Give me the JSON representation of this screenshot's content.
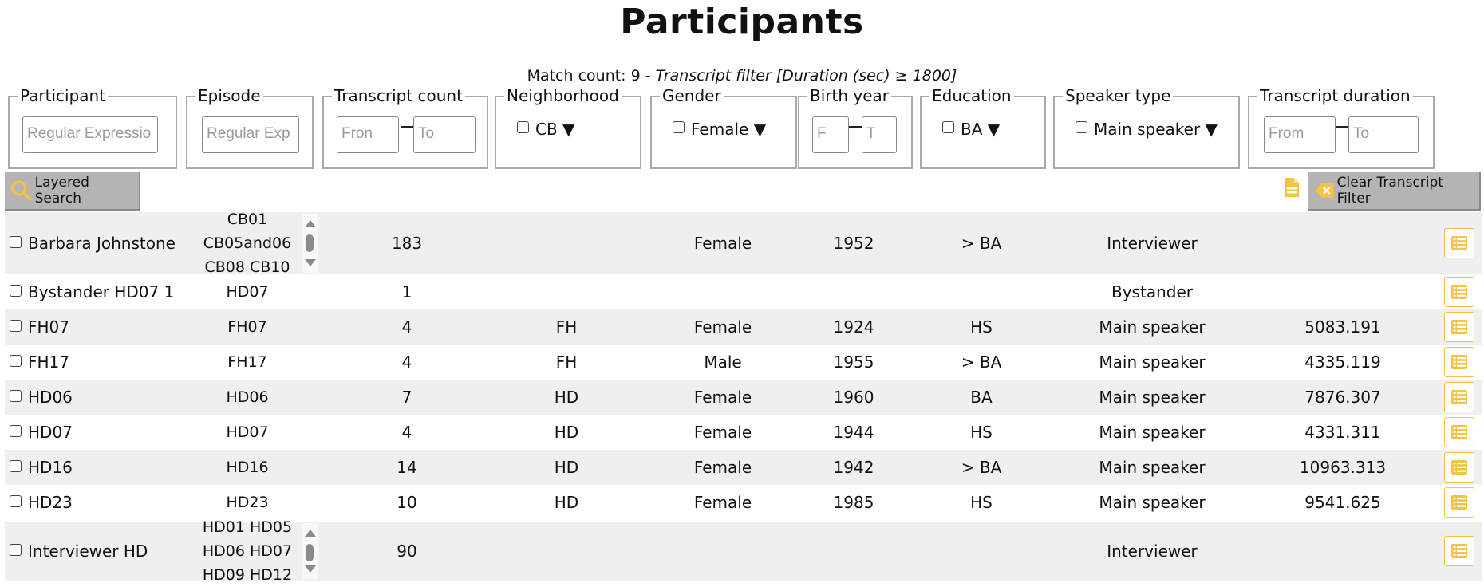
{
  "title": "Participants",
  "match": {
    "prefix": "Match count: 9 - ",
    "filter": "Transcript filter [Duration (sec) ≥ 1800]"
  },
  "filters": {
    "participant": {
      "legend": "Participant",
      "placeholder": "Regular Expressio"
    },
    "episode": {
      "legend": "Episode",
      "placeholder": "Regular Exp"
    },
    "transcript_count": {
      "legend": "Transcript count",
      "from": "Fron",
      "to": "To"
    },
    "neighborhood": {
      "legend": "Neighborhood",
      "value": "CB"
    },
    "gender": {
      "legend": "Gender",
      "value": "Female"
    },
    "birth_year": {
      "legend": "Birth year",
      "from": "F",
      "to": "T"
    },
    "education": {
      "legend": "Education",
      "value": "BA"
    },
    "speaker_type": {
      "legend": "Speaker type",
      "value": "Main speaker"
    },
    "transcript_duration": {
      "legend": "Transcript duration",
      "from": "From",
      "to": "To"
    }
  },
  "toolbar": {
    "layered_search": "Layered Search",
    "clear_filter": "Clear Transcript Filter"
  },
  "rows": [
    {
      "name": "Barbara Johnstone",
      "episodes": [
        "CB01",
        "CB05and06",
        "CB08 CB10"
      ],
      "count": "183",
      "neighborhood": "",
      "gender": "Female",
      "birth": "1952",
      "education": "> BA",
      "speaker": "Interviewer",
      "duration": ""
    },
    {
      "name": "Bystander HD07 1",
      "episodes": [
        "HD07"
      ],
      "count": "1",
      "neighborhood": "",
      "gender": "",
      "birth": "",
      "education": "",
      "speaker": "Bystander",
      "duration": ""
    },
    {
      "name": "FH07",
      "episodes": [
        "FH07"
      ],
      "count": "4",
      "neighborhood": "FH",
      "gender": "Female",
      "birth": "1924",
      "education": "HS",
      "speaker": "Main speaker",
      "duration": "5083.191"
    },
    {
      "name": "FH17",
      "episodes": [
        "FH17"
      ],
      "count": "4",
      "neighborhood": "FH",
      "gender": "Male",
      "birth": "1955",
      "education": "> BA",
      "speaker": "Main speaker",
      "duration": "4335.119"
    },
    {
      "name": "HD06",
      "episodes": [
        "HD06"
      ],
      "count": "7",
      "neighborhood": "HD",
      "gender": "Female",
      "birth": "1960",
      "education": "BA",
      "speaker": "Main speaker",
      "duration": "7876.307"
    },
    {
      "name": "HD07",
      "episodes": [
        "HD07"
      ],
      "count": "4",
      "neighborhood": "HD",
      "gender": "Female",
      "birth": "1944",
      "education": "HS",
      "speaker": "Main speaker",
      "duration": "4331.311"
    },
    {
      "name": "HD16",
      "episodes": [
        "HD16"
      ],
      "count": "14",
      "neighborhood": "HD",
      "gender": "Female",
      "birth": "1942",
      "education": "> BA",
      "speaker": "Main speaker",
      "duration": "10963.313"
    },
    {
      "name": "HD23",
      "episodes": [
        "HD23"
      ],
      "count": "10",
      "neighborhood": "HD",
      "gender": "Female",
      "birth": "1985",
      "education": "HS",
      "speaker": "Main speaker",
      "duration": "9541.625"
    },
    {
      "name": "Interviewer HD",
      "episodes": [
        "HD01 HD05",
        "HD06 HD07",
        "HD09 HD12"
      ],
      "count": "90",
      "neighborhood": "",
      "gender": "",
      "birth": "",
      "education": "",
      "speaker": "Interviewer",
      "duration": ""
    }
  ],
  "colors": {
    "accent": "#f5c242",
    "toolbar_bg": "#b4b4b4",
    "row_shade": "#efefef"
  }
}
